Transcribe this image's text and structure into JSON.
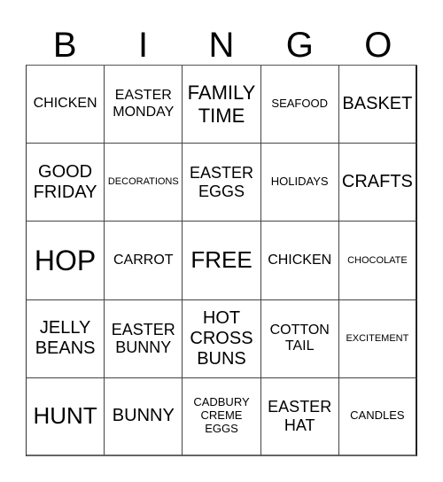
{
  "header": {
    "letters": [
      "B",
      "I",
      "N",
      "G",
      "O"
    ]
  },
  "card": {
    "rows": [
      [
        {
          "text": "CHICKEN",
          "size": "md"
        },
        {
          "text": "EASTER\nMONDAY",
          "size": "md"
        },
        {
          "text": "FAMILY\nTIME",
          "size": "xl"
        },
        {
          "text": "SEAFOOD",
          "size": "sm"
        },
        {
          "text": "BASKET",
          "size": "lg"
        }
      ],
      [
        {
          "text": "GOOD\nFRIDAY",
          "size": "lg"
        },
        {
          "text": "DECORATIONS",
          "size": "xs"
        },
        {
          "text": "EASTER\nEGGS",
          "size": "ml"
        },
        {
          "text": "HOLIDAYS",
          "size": "sm"
        },
        {
          "text": "CRAFTS",
          "size": "lg"
        }
      ],
      [
        {
          "text": "HOP",
          "size": "huge"
        },
        {
          "text": "CARROT",
          "size": "md"
        },
        {
          "text": "FREE",
          "size": "xxl"
        },
        {
          "text": "CHICKEN",
          "size": "md"
        },
        {
          "text": "CHOCOLATE",
          "size": "xs"
        }
      ],
      [
        {
          "text": "JELLY\nBEANS",
          "size": "lg"
        },
        {
          "text": "EASTER\nBUNNY",
          "size": "ml"
        },
        {
          "text": "HOT\nCROSS\nBUNS",
          "size": "lg"
        },
        {
          "text": "COTTON\nTAIL",
          "size": "md"
        },
        {
          "text": "EXCITEMENT",
          "size": "xs"
        }
      ],
      [
        {
          "text": "HUNT",
          "size": "xxl"
        },
        {
          "text": "BUNNY",
          "size": "lg"
        },
        {
          "text": "CADBURY\nCREME\nEGGS",
          "size": "sm"
        },
        {
          "text": "EASTER\nHAT",
          "size": "ml"
        },
        {
          "text": "CANDLES",
          "size": "sm"
        }
      ]
    ]
  }
}
